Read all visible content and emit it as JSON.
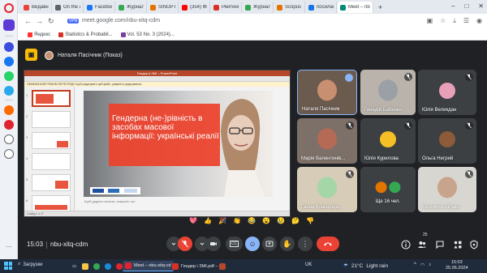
{
  "browser": {
    "tabs": [
      {
        "label": "Видавництв",
        "color": "#ea4335"
      },
      {
        "label": "On the asy",
        "color": "#5f6368"
      },
      {
        "label": "Facebook",
        "color": "#1877f2"
      },
      {
        "label": "Журнал уч",
        "color": "#34a853"
      },
      {
        "label": "SINOPTIK:",
        "color": "#e37400"
      },
      {
        "label": "(354) Фюз",
        "color": "#ff0000"
      },
      {
        "label": "Рейтинг ст",
        "color": "#d93025"
      },
      {
        "label": "Журнал уч",
        "color": "#34a853"
      },
      {
        "label": "Scopus - p",
        "color": "#e37400"
      },
      {
        "label": "посилання",
        "color": "#1a73e8"
      },
      {
        "label": "Meet – nbu",
        "color": "#00897b"
      }
    ],
    "new_tab": "+",
    "window_controls": {
      "minimize": "–",
      "maximize": "□",
      "close": "✕"
    },
    "vpn_label": "VPN",
    "url": "meet.google.com/nbu-xitq-cdm",
    "bookmarks": [
      {
        "label": "Яндекс",
        "color": "#ff3333"
      },
      {
        "label": "Statistics & Probabil...",
        "color": "#d93025"
      },
      {
        "label": "Vol. 53 No. 3 (2024)...",
        "color": "#7b3fa0"
      }
    ]
  },
  "meet": {
    "presenter_label": "Наталя Пасічник (Показ)",
    "meeting_time": "15:03",
    "meeting_code": "nbu-xitq-cdm",
    "people_count": "25",
    "reactions": [
      "💖",
      "👍",
      "🎉",
      "👏",
      "😂",
      "😮",
      "😢",
      "🤔",
      "👎"
    ],
    "participants": [
      {
        "name": "Наталя Пасічник",
        "color": "#c88f70"
      },
      {
        "name": "Генадій Бабенко",
        "color": "#9aa0a6"
      },
      {
        "name": "Юлія Великдан",
        "color": "#e8a0b8"
      },
      {
        "name": "Марія Валентинів...",
        "color": "#b46a55"
      },
      {
        "name": "Юлія Курилова",
        "color": "#f6bf26"
      },
      {
        "name": "Ольга Негрий",
        "color": "#8e5a3a"
      },
      {
        "name": "Ганна Красноща...",
        "color": "#a5d6a7"
      },
      {
        "name": "Ще 16 чел.",
        "color": "#5f6368"
      },
      {
        "name": "Катерина Акбаш",
        "color": "#c8a48c"
      }
    ]
  },
  "slide": {
    "app_title": "Гендер в ЗМІ – PowerPoint",
    "notice": "ОБМЕЖЕНИЙ РЕЖИМ ПЕРЕГЛЯДУ  Щоб редагувати цей файл, увімкніть редагування.",
    "title": "Гендерна (не-)рівність в засобах масової інформації: українські реалії",
    "notes_placeholder": "Щоб додати нотатки, клацніть тут",
    "status": "Слайд 1 з 17"
  },
  "taskbar": {
    "search_label": "Загрузки",
    "apps": [
      {
        "label": "Meet – nbu-xitq-cd",
        "color": "#e0242f"
      },
      {
        "label": "Гендер і ЗМІ.pdf – ...",
        "color": "#d93025"
      },
      {
        "label": "",
        "color": "#b7472a"
      }
    ],
    "language": "UK",
    "weather": {
      "temp": "21°C",
      "condition": "Light rain"
    },
    "time": "15:03",
    "date": "25.06.2024"
  }
}
